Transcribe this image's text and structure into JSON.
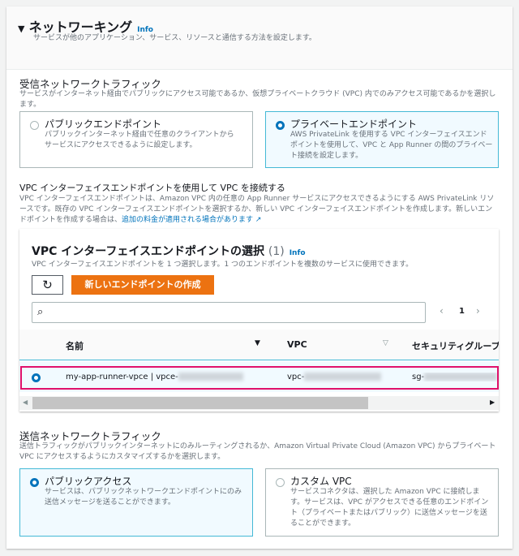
{
  "header": {
    "title": "ネットワーキング",
    "info": "Info",
    "description": "サービスが他のアプリケーション、サービス、リソースと通信する方法を設定します。"
  },
  "incoming": {
    "title": "受信ネットワークトラフィック",
    "description": "サービスがインターネット経由でパブリックにアクセス可能であるか、仮想プライベートクラウド (VPC) 内でのみアクセス可能であるかを選択します。",
    "options": [
      {
        "label": "パブリックエンドポイント",
        "description": "パブリックインターネット経由で任意のクライアントからサービスにアクセスできるように設定します。",
        "selected": false
      },
      {
        "label": "プライベートエンドポイント",
        "description": "AWS PrivateLink を使用する VPC インターフェイスエンドポイントを使用して、VPC と App Runner の間のプライベート接続を設定します。",
        "selected": true
      }
    ]
  },
  "vpc_connect": {
    "title": "VPC インターフェイスエンドポイントを使用して VPC を接続する",
    "description": "VPC インターフェイスエンドポイントは、Amazon VPC 内の任意の App Runner サービスにアクセスできるようにする AWS PrivateLink リソースです。既存の VPC インターフェイスエンドポイントを選択するか、新しい VPC インターフェイスエンドポイントを作成します。新しいエンドポイントを作成する場合は、",
    "link": "追加の料金が適用される場合があります"
  },
  "table": {
    "title": "VPC インターフェイスエンドポイントの選択",
    "count": "(1)",
    "info": "Info",
    "description": "VPC インターフェイスエンドポイントを 1 つ選択します。1 つのエンドポイントを複数のサービスに使用できます。",
    "create_button": "新しいエンドポイントの作成",
    "search_placeholder": "",
    "page": "1",
    "columns": [
      "名前",
      "VPC",
      "セキュリティグループ"
    ],
    "rows": [
      {
        "name": "my-app-runner-vpce | vpce-",
        "vpc": "vpc-",
        "sg": "sg-",
        "selected": true
      }
    ]
  },
  "outgoing": {
    "title": "送信ネットワークトラフィック",
    "description": "送信トラフィックがパブリックインターネットにのみルーティングされるか、Amazon Virtual Private Cloud (Amazon VPC) からプライベート VPC にアクセスするようにカスタマイズするかを選択します。",
    "options": [
      {
        "label": "パブリックアクセス",
        "description": "サービスは、パブリックネットワークエンドポイントにのみ送信メッセージを送ることができます。",
        "selected": true
      },
      {
        "label": "カスタム VPC",
        "description": "サービスコネクタは、選択した Amazon VPC に接続します。サービスは、VPC がアクセスできる任意のエンドポイント（プライベートまたはパブリック）に送信メッセージを送ることができます。",
        "selected": false
      }
    ]
  },
  "colors": {
    "accent": "#0073bb",
    "primary_button": "#ec7211",
    "highlight": "#e0116b"
  }
}
